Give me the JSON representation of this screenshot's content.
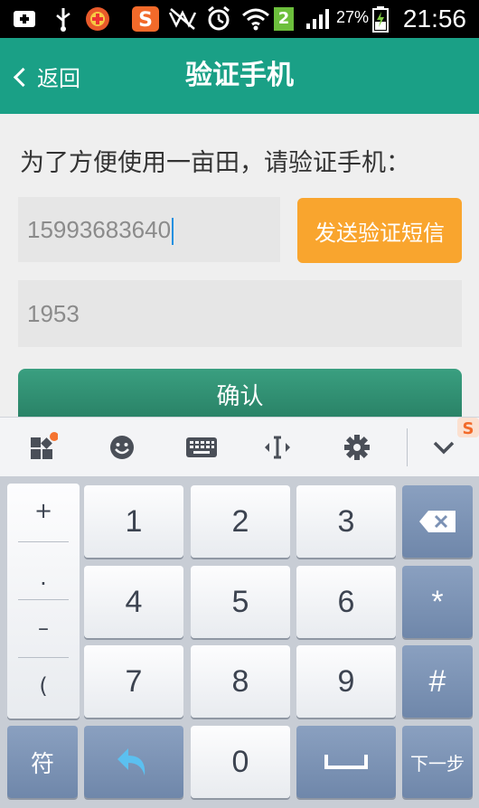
{
  "status_bar": {
    "battery_percent": "27%",
    "time": "21:56",
    "sim_badge": "2",
    "icons": [
      "plus-icon",
      "usb-icon",
      "notification-app-icon",
      "sogou-icon",
      "no-sound-icon",
      "alarm-icon",
      "wifi-icon",
      "sim-2-icon",
      "signal-icon",
      "battery-icon"
    ]
  },
  "header": {
    "back_label": "返回",
    "title": "验证手机"
  },
  "form": {
    "prompt": "为了方便使用一亩田，请验证手机：",
    "phone_value": "15993683640",
    "send_button": "发送验证短信",
    "code_value": "1953",
    "confirm_button": "确认"
  },
  "colors": {
    "header": "#1aa086",
    "send_button": "#f9a52e",
    "confirm_button": "#2e8c6f",
    "cursor": "#1e90e0"
  },
  "keyboard": {
    "toolbar_icons": [
      "apps-icon",
      "emoji-icon",
      "keyboard-icon",
      "cursor-move-icon",
      "gear-icon",
      "chevron-down-icon"
    ],
    "symbols": [
      "+",
      ".",
      "–",
      "("
    ],
    "digits": [
      "1",
      "2",
      "3",
      "4",
      "5",
      "6",
      "7",
      "8",
      "9"
    ],
    "right_keys": [
      "*",
      "#"
    ],
    "bottom": {
      "symbol_key": "符",
      "zero": "0",
      "next": "下一步"
    }
  }
}
